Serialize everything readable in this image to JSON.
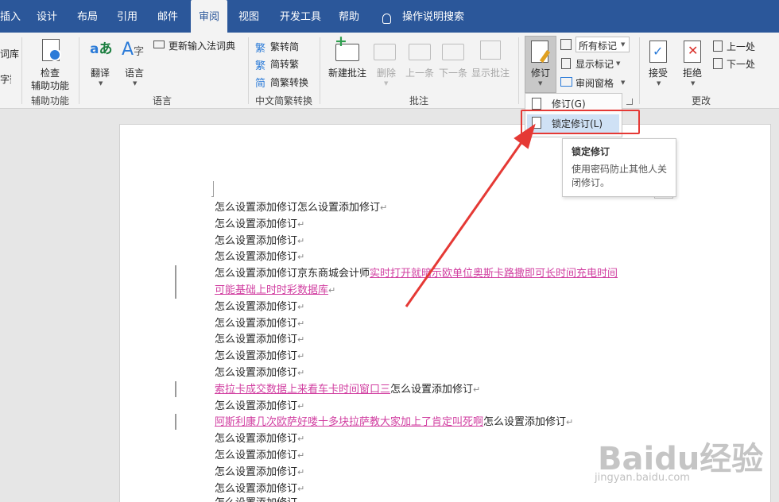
{
  "tabs": [
    "插入",
    "设计",
    "布局",
    "引用",
    "邮件",
    "审阅",
    "视图",
    "开发工具",
    "帮助"
  ],
  "search_label": "操作说明搜索",
  "left_partial": [
    "词库",
    "字数统计"
  ],
  "accessibility": {
    "button": "检查辅助功能",
    "line1": "检查",
    "line2": "辅助功能",
    "group": "辅助功能"
  },
  "language": {
    "translate": "翻译",
    "language": "语言",
    "update_ime": "更新输入法词典",
    "group": "语言"
  },
  "chinese": {
    "to_simplified": "繁转简",
    "to_traditional": "简转繁",
    "convert": "简繁转换",
    "group": "中文简繁转换"
  },
  "comments": {
    "new": "新建批注",
    "delete": "删除",
    "prev": "上一条",
    "next": "下一条",
    "show": "显示批注",
    "group": "批注"
  },
  "tracking": {
    "track": "修订",
    "all_markup": "所有标记",
    "show_markup": "显示标记",
    "review_pane": "审阅窗格"
  },
  "changes": {
    "accept": "接受",
    "reject": "拒绝",
    "prev": "上一处",
    "next": "下一处",
    "group": "更改"
  },
  "dropdown": {
    "track_changes": "修订(G)",
    "lock_tracking": "锁定修订(L)"
  },
  "tooltip": {
    "title": "锁定修订",
    "desc": "使用密码防止其他人关闭修订。"
  },
  "doc": {
    "line0": "怎么设置添加修订怎么设置添加修订",
    "repeat": "怎么设置添加修订",
    "line4_prefix": "怎么设置添加修订京东商城会计师",
    "line4_ins": "实时打开就暗示欧单位奥斯卡路撒即可长时间充电时间",
    "line5_ins": "可能基础上时时彩数据库",
    "ins2": "索拉卡成交数据上来看车卡时间窗口三",
    "ins2_suffix": "怎么设置添加修订",
    "ins3": "阿斯利康几次欧萨好喽十多块拉萨教大家加上了肯定叫死啊",
    "ins3_suffix": "怎么设置添加修订",
    "para_mark": "↵"
  },
  "watermark": {
    "brand": "Baidu经验",
    "url": "jingyan.baidu.com"
  },
  "colors": {
    "tabbar": "#2b579a",
    "insertion": "#d13fa1",
    "highlight": "#e53935"
  }
}
